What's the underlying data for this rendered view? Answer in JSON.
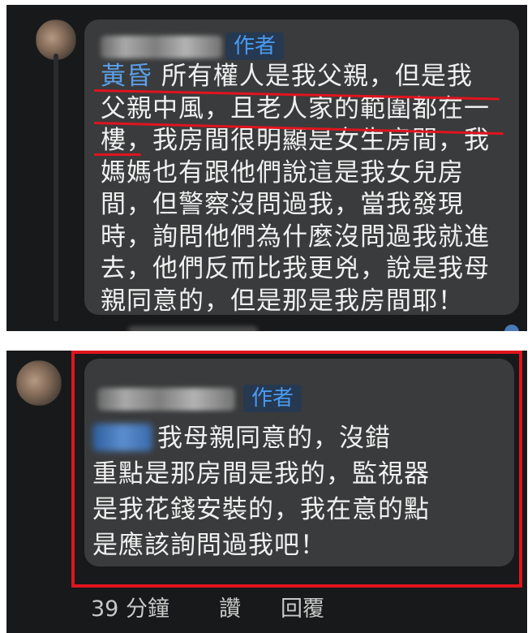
{
  "comment1": {
    "author_badge": "作者",
    "mention": "黃昏",
    "lines": [
      "所有權人是我父親，但是我",
      "父親中風，且老人家的範圍都在一",
      "樓，我房間很明顯是女生房間，我",
      "媽媽也有跟他們說這是我女兒房",
      "間，但警察沒問過我，當我發現",
      "時，詢問他們為什麼沒問過我就進",
      "去，他們反而比我更兇，說是我母",
      "親同意的，但是那是我房間耶！"
    ]
  },
  "comment2": {
    "author_badge": "作者",
    "lines": [
      "我母親同意的，沒錯",
      "重點是那房間是我的，監視器",
      "是我花錢安裝的，我在意的點",
      "是應該詢問過我吧！"
    ],
    "highlight_color": "#e0141e",
    "actions": {
      "time": "39 分鐘",
      "like": "讚",
      "reply": "回覆"
    }
  }
}
